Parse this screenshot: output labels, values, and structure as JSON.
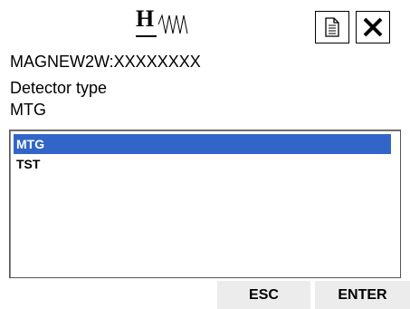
{
  "header": {
    "logo_text": "H",
    "logo_icon": "wave-logo",
    "doc_icon": "document-icon",
    "close_icon": "close-icon"
  },
  "device_id": "MAGNEW2W:XXXXXXXX",
  "field": {
    "label": "Detector type",
    "current_value": "MTG"
  },
  "list": {
    "items": [
      "MTG",
      "TST"
    ],
    "selected_index": 0,
    "selected_color": "#3265c8"
  },
  "buttons": {
    "esc_label": "ESC",
    "enter_label": "ENTER"
  }
}
